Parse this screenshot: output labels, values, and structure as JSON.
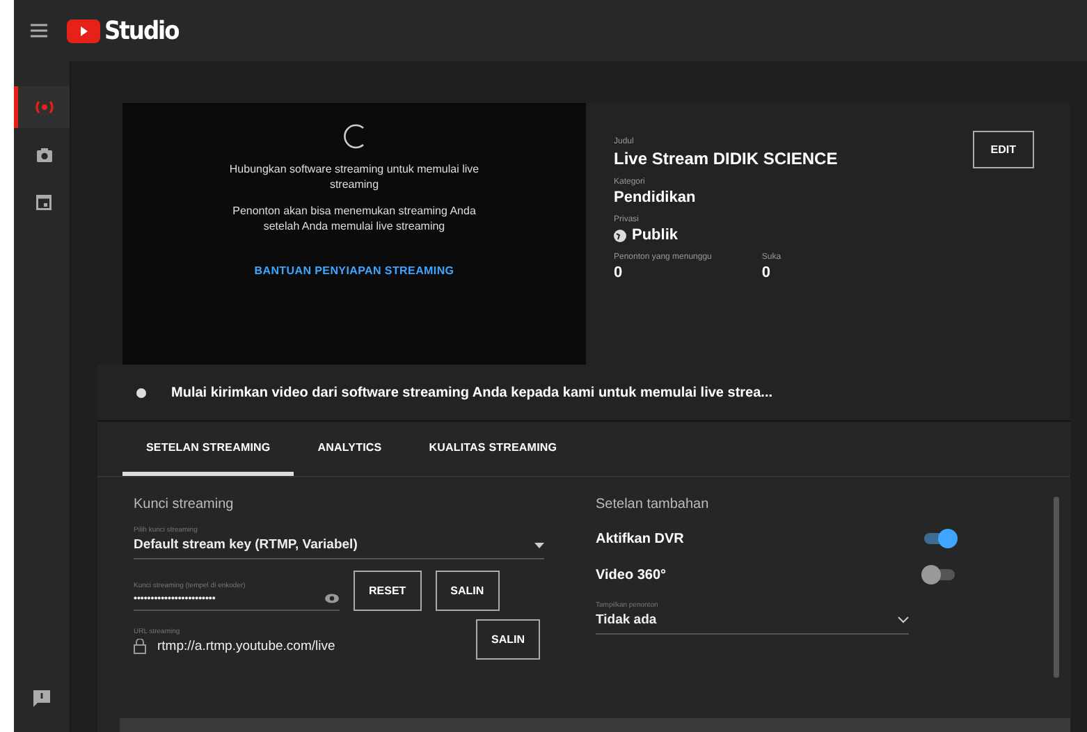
{
  "header": {
    "logo_text": "Studio"
  },
  "sidebar": {
    "items": [
      {
        "kind": "live",
        "selected": true
      },
      {
        "kind": "camera",
        "selected": false
      },
      {
        "kind": "calendar",
        "selected": false
      }
    ]
  },
  "preview": {
    "message_1": "Hubungkan software streaming untuk memulai live streaming",
    "message_2": "Penonton akan bisa menemukan streaming Anda setelah Anda memulai live streaming",
    "help_link": "BANTUAN PENYIAPAN STREAMING"
  },
  "details": {
    "title_label": "Judul",
    "title": "Live Stream DIDIK SCIENCE",
    "edit_button": "EDIT",
    "category_label": "Kategori",
    "category": "Pendidikan",
    "privacy_label": "Privasi",
    "privacy": "Publik",
    "waiting_label": "Penonton yang menunggu",
    "waiting": "0",
    "likes_label": "Suka",
    "likes": "0"
  },
  "status": {
    "message": "Mulai kirimkan video dari software streaming Anda kepada kami untuk memulai live strea..."
  },
  "tabs": [
    {
      "label": "SETELAN STREAMING",
      "selected": true
    },
    {
      "label": "ANALYTICS",
      "selected": false
    },
    {
      "label": "KUALITAS STREAMING",
      "selected": false
    }
  ],
  "stream_key": {
    "heading": "Kunci streaming",
    "select_label": "Pilih kunci streaming",
    "select_value": "Default stream key (RTMP, Variabel)",
    "key_label": "Kunci streaming (tempel di enkoder)",
    "key_value": "••••••••••••••••••••••••",
    "reset_button": "RESET",
    "copy_button": "SALIN",
    "url_label": "URL streaming",
    "url_value": "rtmp://a.rtmp.youtube.com/live",
    "url_copy_button": "SALIN"
  },
  "extra": {
    "heading": "Setelan tambahan",
    "toggles": [
      {
        "label": "Aktifkan DVR",
        "on": true
      },
      {
        "label": "Video 360°",
        "on": false
      }
    ],
    "select_label": "Tampilkan penonton",
    "select_value": "Tidak ada"
  }
}
